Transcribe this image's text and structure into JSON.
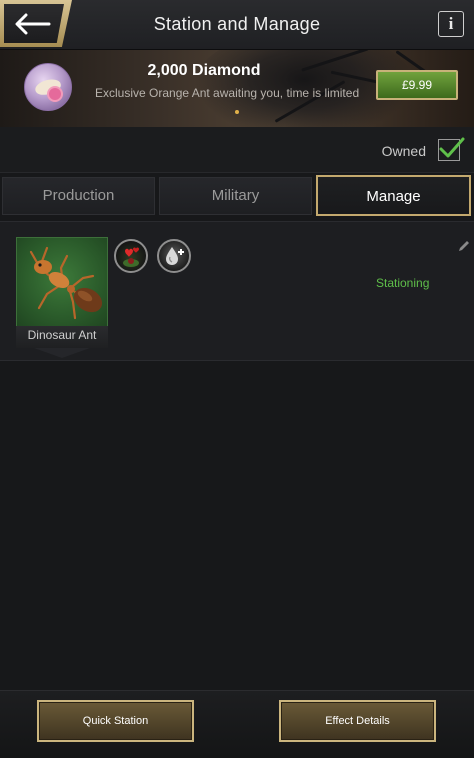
{
  "header": {
    "title": "Station and Manage",
    "info_label": "i"
  },
  "banner": {
    "title": "2,000 Diamond",
    "subtitle": "Exclusive Orange Ant awaiting you, time is limited",
    "price": "£9.99"
  },
  "owned": {
    "label": "Owned",
    "checked": true
  },
  "tabs": [
    {
      "label": "Production",
      "active": false
    },
    {
      "label": "Military",
      "active": false
    },
    {
      "label": "Manage",
      "active": true
    }
  ],
  "units": [
    {
      "name": "Dinosaur Ant",
      "status": "Stationing",
      "status_color": "#5fbf4a"
    }
  ],
  "actions": {
    "quick_station": "Quick Station",
    "effect_details": "Effect Details"
  },
  "colors": {
    "accent_gold": "#c3a96e",
    "price_green": "#5b8d30",
    "status_green": "#5fbf4a"
  }
}
